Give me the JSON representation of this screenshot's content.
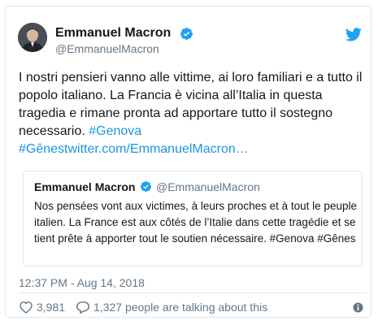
{
  "author": {
    "name": "Emmanuel Macron",
    "handle": "@EmmanuelMacron"
  },
  "tweet": {
    "text_line": "I nostri pensieri vanno alle vittime, ai loro familiari e a tutto il popolo italiano. La Francia è vicina all’Italia in questa tragedia e rimane pronta ad apportare tutto il sostegno necessario. ",
    "hashtag_genova": "#Genova",
    "link_text": "#Gênestwitter.com/EmmanuelMacron…"
  },
  "quoted": {
    "name": "Emmanuel Macron",
    "handle": "@EmmanuelMacron",
    "text": "Nos pensées vont aux victimes, à leurs proches et à tout le peuple italien. La France est aux côtés de l’Italie dans cette tragédie et se tient prête à apporter tout le soutien nécessaire. #Genova #Gênes"
  },
  "meta": {
    "timestamp": "12:37 PM - Aug 14, 2018",
    "like_count": "3,981",
    "talking_text": "1,327 people are talking about this"
  },
  "colors": {
    "link": "#1b95e0",
    "verified": "#1da1f2",
    "muted": "#657786",
    "border": "#e1e8ed"
  },
  "icons": [
    "verified-icon",
    "twitter-bird-icon",
    "heart-icon",
    "reply-icon",
    "info-icon"
  ]
}
